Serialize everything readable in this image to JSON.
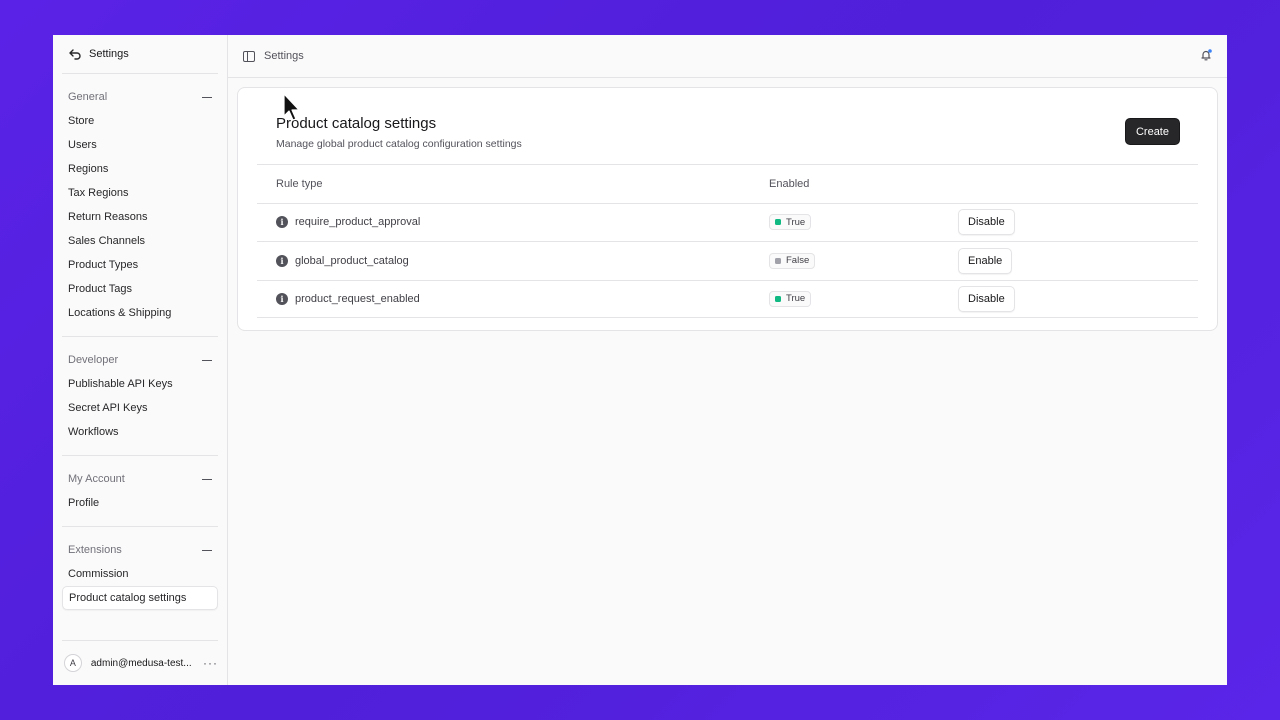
{
  "sidebar": {
    "header_label": "Settings",
    "sections": [
      {
        "title": "General",
        "items": [
          "Store",
          "Users",
          "Regions",
          "Tax Regions",
          "Return Reasons",
          "Sales Channels",
          "Product Types",
          "Product Tags",
          "Locations & Shipping"
        ]
      },
      {
        "title": "Developer",
        "items": [
          "Publishable API Keys",
          "Secret API Keys",
          "Workflows"
        ]
      },
      {
        "title": "My Account",
        "items": [
          "Profile"
        ]
      },
      {
        "title": "Extensions",
        "items": [
          "Commission",
          "Product catalog settings"
        ]
      }
    ],
    "active_item": "Product catalog settings",
    "user": {
      "avatar_letter": "A",
      "email": "admin@medusa-test...",
      "menu": "···"
    }
  },
  "topbar": {
    "breadcrumb": "Settings"
  },
  "card": {
    "title": "Product catalog settings",
    "subtitle": "Manage global product catalog configuration settings",
    "create_label": "Create",
    "columns": [
      "Rule type",
      "Enabled"
    ],
    "rows": [
      {
        "rule": "require_product_approval",
        "enabled": "True",
        "dot_color": "#10b981",
        "action": "Disable"
      },
      {
        "rule": "global_product_catalog",
        "enabled": "False",
        "dot_color": "#a1a1aa",
        "action": "Enable"
      },
      {
        "rule": "product_request_enabled",
        "enabled": "True",
        "dot_color": "#10b981",
        "action": "Disable"
      }
    ]
  },
  "colors": {
    "background": "#5a22e6",
    "accent_true": "#10b981",
    "accent_false": "#a1a1aa",
    "button_dark": "#27272a"
  },
  "icons": {
    "back": "arrow-back-icon",
    "panel": "sidebar-toggle-icon",
    "bell": "bell-icon",
    "info": "info-icon"
  }
}
